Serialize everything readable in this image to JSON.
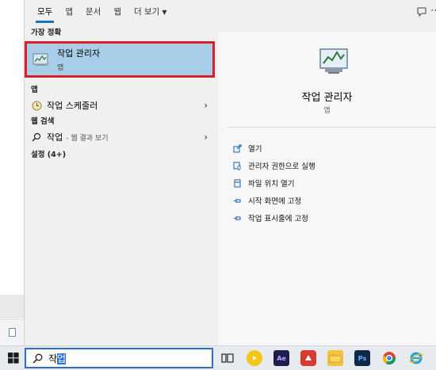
{
  "tabs": [
    {
      "label": "모두",
      "active": true
    },
    {
      "label": "앱"
    },
    {
      "label": "문서"
    },
    {
      "label": "웹"
    },
    {
      "label": "더 보기"
    }
  ],
  "results": {
    "best_match_label": "가장 정확",
    "best_match": {
      "title": "작업 관리자",
      "subtitle": "앱"
    },
    "apps_label": "앱",
    "app_item": {
      "title": "작업 스케줄러"
    },
    "web_label": "웹 검색",
    "web_item": {
      "title": "작업",
      "subtitle": "- 웹 결과 보기"
    },
    "settings_label": "설정 (4+)"
  },
  "detail": {
    "title": "작업 관리자",
    "subtitle": "앱",
    "actions": [
      {
        "label": "열기",
        "icon": "open-icon"
      },
      {
        "label": "관리자 권한으로 실행",
        "icon": "shield-icon"
      },
      {
        "label": "파일 위치 열기",
        "icon": "file-location-icon"
      },
      {
        "label": "시작 화면에 고정",
        "icon": "pin-icon"
      },
      {
        "label": "작업 표시줄에 고정",
        "icon": "pin-icon"
      }
    ]
  },
  "taskbar": {
    "search_value_plain": "작",
    "search_value_selected": "업",
    "apps": [
      "task-view-icon",
      "kakaotalk-icon",
      "after-effects-icon",
      "app-icon",
      "file-explorer-icon",
      "photoshop-icon",
      "chrome-icon",
      "internet-explorer-icon"
    ],
    "ae_label": "Ae",
    "ps_label": "Ps"
  },
  "colors": {
    "accent": "#1a73c8",
    "selection": "#a8cde8",
    "highlight_border": "#d91f27"
  }
}
